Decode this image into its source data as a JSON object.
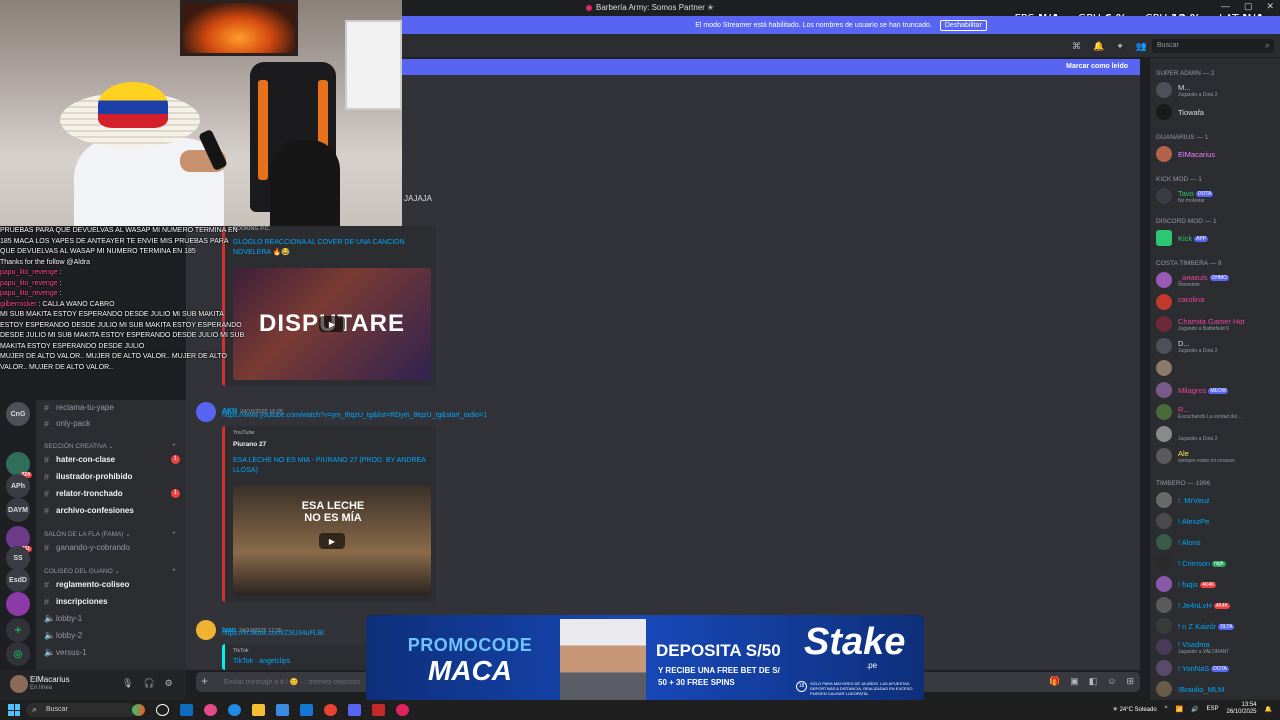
{
  "titlebar": {
    "title": "Barbería Army: Somos Partner ✭"
  },
  "stats": [
    {
      "label": "FPS",
      "value": "N/A"
    },
    {
      "label": "GPU",
      "value": "6 %"
    },
    {
      "label": "CPU",
      "value": "12 %"
    },
    {
      "label": "LAT",
      "value": "N/A"
    }
  ],
  "streamer_banner": {
    "text": "El modo Streamer está habilitado. Los nombres de usuario se han truncado.",
    "button": "Deshabilitar"
  },
  "header": {
    "search_placeholder": "Buscar"
  },
  "unread_bar": {
    "mark_read": "Marcar como leído"
  },
  "overlay_chat": [
    {
      "text": "PRUEBAS PARA QUE DEVUELVAS AL WASAP MI NUMERO TERMINA EN 185 MACA LOS YAPES DE ANTEAYER TE ENVIE MIS PRUEBAS PARA QUE DEVUELVAS AL WASAP MI NUMERO TERMINA EN 185"
    },
    {
      "name": "",
      "text": "Thanks for the follow @Aldra"
    },
    {
      "name": "papu_lito_revenge",
      "text": ""
    },
    {
      "name": "papu_lito_revenge",
      "text": ""
    },
    {
      "name": "papu_lito_revenge",
      "text": ""
    },
    {
      "name": "gilberrocker",
      "text": "CALLA WANO CABRO"
    },
    {
      "name": "",
      "text": "MI SUB MAKITA ESTOY ESPERANDO DESDE JULIO MI SUB MAKITA ESTOY ESPERANDO DESDE JULIO MI SUB MAKITA ESTOY ESPERANDO DESDE JULIO MI SUB MAKITA ESTOY ESPERANDO DESDE JULIO MI SUB MAKITA ESTOY ESPERANDO DESDE JULIO"
    },
    {
      "name": "",
      "text": "MUJER DE ALTO VALOR.. MUJER DE ALTO VALOR.. MUJER DE ALTO VALOR.. MUJER DE ALTO VALOR.."
    }
  ],
  "servers": [
    {
      "label": "CnG",
      "badge": ""
    },
    {
      "label": "",
      "badge": "224"
    },
    {
      "label": "APh",
      "badge": ""
    },
    {
      "label": "DAYM",
      "badge": ""
    },
    {
      "label": "",
      "badge": "111"
    },
    {
      "label": "SS",
      "badge": ""
    },
    {
      "label": "EsdD",
      "badge": ""
    },
    {
      "label": "",
      "badge": ""
    },
    {
      "label": "+",
      "badge": ""
    },
    {
      "label": "◎",
      "badge": ""
    }
  ],
  "channels": [
    {
      "name": "reclama-tu-yape",
      "bright": false,
      "unread": ""
    },
    {
      "name": "only-pack",
      "bright": false,
      "unread": ""
    },
    {
      "type": "category",
      "name": "SECCIÓN CREATIVA"
    },
    {
      "name": "hater-con-clase",
      "bright": true,
      "unread": "1"
    },
    {
      "name": "ilustrador-prohibido",
      "bright": true,
      "unread": ""
    },
    {
      "name": "relator-tronchado",
      "bright": true,
      "unread": "1"
    },
    {
      "name": "archivo-confesiones",
      "bright": true,
      "unread": ""
    },
    {
      "type": "category",
      "name": "SALÓN DE LA FLA (FAMA)"
    },
    {
      "name": "ganando-y-cobrando",
      "bright": false,
      "unread": ""
    },
    {
      "type": "category",
      "name": "COLISEO DEL GUANO"
    },
    {
      "name": "reglamento-coliseo",
      "bright": true,
      "unread": ""
    },
    {
      "name": "inscripciones",
      "bright": true,
      "unread": ""
    },
    {
      "name": "lobby-1",
      "bright": false,
      "unread": ""
    },
    {
      "name": "lobby-2",
      "bright": false,
      "unread": ""
    },
    {
      "name": "versus-1",
      "bright": false,
      "unread": ""
    }
  ],
  "user_panel": {
    "name": "ElMacarius",
    "status": "En línea"
  },
  "messages": {
    "top_fragment": "JAJAJA",
    "embed1": {
      "provider": "BOOKING P.C.",
      "title": "GLOGLO REACCIONA AL COVER DE UNA CANCION NOVELERA 🔥😂",
      "thumb_text": "DISPUTARE"
    },
    "msg2": {
      "author": "AKN",
      "time": "24/10/2025 16:25",
      "link": "https://www.youtube.com/watch?v=ym_8tqzU_tg&list=RDym_8tqzU_tg&start_radio=1",
      "provider": "YouTube",
      "channel": "Piurano 27",
      "title": "ESA LECHE NO ES MIA - PIURANO 27 (PROD. BY ANDREA LLOSA)",
      "thumb_text": "ESA LECHE NO ES MÍA"
    },
    "msg3": {
      "author": "Ivan",
      "time": "24/10/2025 17:05",
      "link": "https://vt.tiktok.com/ZSU34uFLB/",
      "provider": "TikTok",
      "title": "TikTok · angelclips"
    }
  },
  "composer": {
    "placeholder": "Enviar mensaje a # / 😊 · : memes-reaccion"
  },
  "member_groups": [
    {
      "title": "SUPER ADMIN — 2"
    },
    {
      "title": "GUANARIUS — 1"
    },
    {
      "title": "KICK MOD — 1"
    },
    {
      "title": "DISCORD MOD — 1"
    },
    {
      "title": "COSTA TIMBERA — 9"
    },
    {
      "title": "TIMBERO — 1996"
    }
  ],
  "members": [
    {
      "name": "M...",
      "activity": "Jugando a Dota 2",
      "color": "#dbdee1",
      "tag": ""
    },
    {
      "name": "Tiowafa",
      "activity": "",
      "color": "#dbdee1",
      "tag": ""
    },
    {
      "name": "ElMacarius",
      "activity": "",
      "color": "#f47fff",
      "tag": ""
    },
    {
      "name": "Tavo",
      "activity": "No molestar",
      "color": "#2dc770",
      "tag": "DOTA"
    },
    {
      "name": "Kick",
      "activity": "",
      "color": "#2dc770",
      "tag": "APP"
    },
    {
      "name": "_анакuis",
      "activity": "/moenime",
      "color": "#eb459e",
      "tag": "OHMO"
    },
    {
      "name": "carolina",
      "activity": "",
      "color": "#eb459e",
      "tag": ""
    },
    {
      "name": "Chamita Gamer Hot",
      "activity": "Jugando a Battlefield 6",
      "color": "#eb459e",
      "tag": ""
    },
    {
      "name": "D...",
      "activity": "Jugando a Dota 2",
      "color": "#dbdee1",
      "tag": ""
    },
    {
      "name": "",
      "activity": "",
      "color": "#eb459e",
      "tag": ""
    },
    {
      "name": "Milagros",
      "activity": "",
      "color": "#eb459e",
      "tag": "MEOW"
    },
    {
      "name": "R...",
      "activity": "Escuchando La verdad del...",
      "color": "#eb459e",
      "tag": ""
    },
    {
      "name": "",
      "activity": "Jugando a Dota 2",
      "color": "#eb459e",
      "tag": ""
    },
    {
      "name": "Ale",
      "activity": "siempre estas mi corazon",
      "color": "#fee75c",
      "tag": ""
    },
    {
      "name": "! .MrVeuz",
      "activity": "",
      "color": "#00a8fc",
      "tag": ""
    },
    {
      "name": "! AlexzPe",
      "activity": "",
      "color": "#00a8fc",
      "tag": ""
    },
    {
      "name": "! Alons",
      "activity": "",
      "color": "#00a8fc",
      "tag": ""
    },
    {
      "name": "! Crimson",
      "activity": "",
      "color": "#00a8fc",
      "tag": "high"
    },
    {
      "name": "! fuqis",
      "activity": "",
      "color": "#00a8fc",
      "tag": "4K4K"
    },
    {
      "name": "! Je4nLvH",
      "activity": "",
      "color": "#00a8fc",
      "tag": "4K4K"
    },
    {
      "name": "! n Z Kaizôr",
      "activity": "",
      "color": "#00a8fc",
      "tag": "DLTA"
    },
    {
      "name": "! Vsadma",
      "activity": "Jugando a VALORANT",
      "color": "#00a8fc",
      "tag": ""
    },
    {
      "name": "! YonNaS",
      "activity": "",
      "color": "#00a8fc",
      "tag": "DOTA"
    },
    {
      "name": "!Braulio_MLM",
      "activity": "",
      "color": "#00a8fc",
      "tag": ""
    }
  ],
  "ad": {
    "promo_line1": "PROMOCODE",
    "promo_line2": "MACA",
    "deposit": "DEPOSITA S/50",
    "deposit_sub": "Y RECIBE UNA FREE BET DE S/ 50 + 30 FREE SPINS",
    "brand": "Stake",
    "brand_sub": ".pe",
    "age": "18",
    "legal": "SÓLO PARA MAYORES DE 18 AÑOS. LAS APUESTAS DEPORTIVAS A DISTANCIA, REALIZADAS EN EXCESO PUEDEN CAUSAR LUDOPATÍA."
  },
  "taskbar": {
    "search": "Buscar",
    "weather": "24°C Soleado",
    "lang": "ESP",
    "time": "13:54",
    "date": "26/10/2025"
  },
  "colors": {
    "accent": "#5865f2",
    "bg": "#313338",
    "sidebar": "#2b2d31",
    "link": "#00a8fc"
  }
}
